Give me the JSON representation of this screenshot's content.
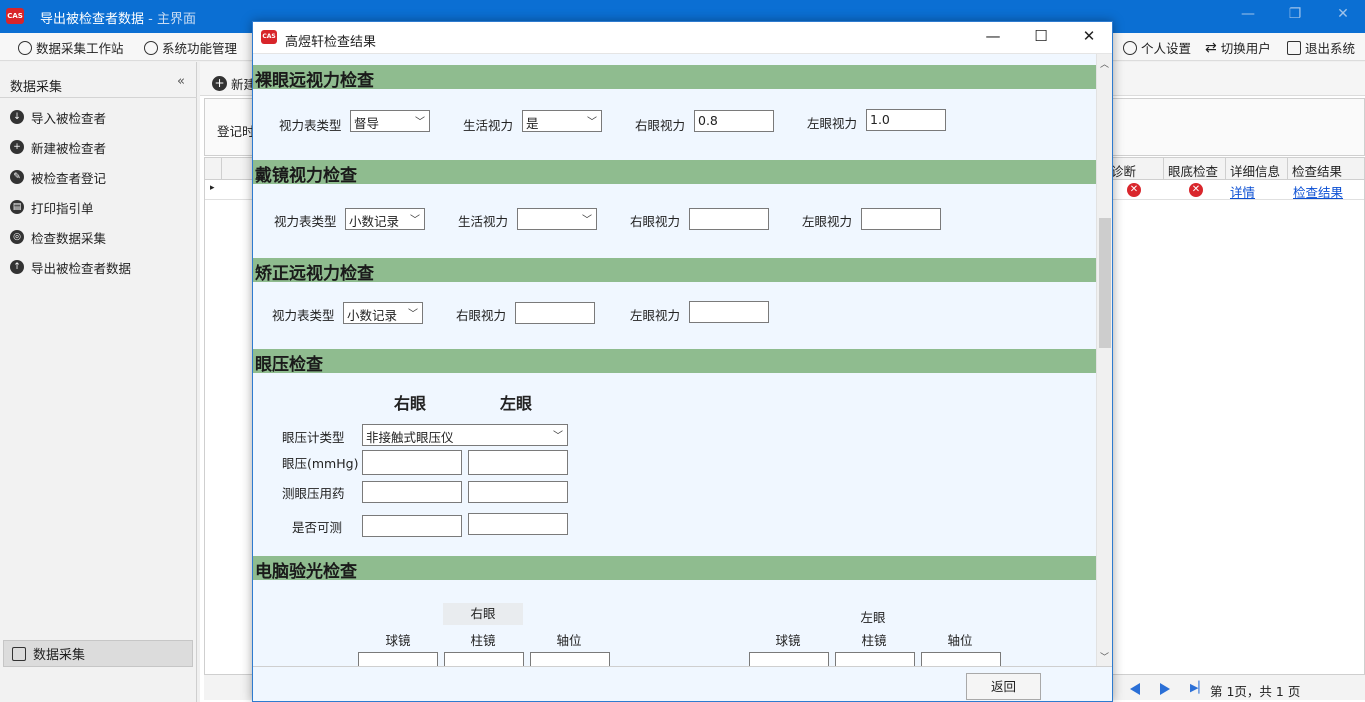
{
  "window": {
    "title": "导出被检查者数据",
    "subtitle": " - 主界面",
    "min": "—",
    "max": "❐",
    "close": "✕"
  },
  "toolbar": {
    "items": [
      "数据采集工作站",
      "系统功能管理"
    ],
    "right": [
      "个人设置",
      "切换用户",
      "退出系统"
    ]
  },
  "sidebar": {
    "header": "数据采集",
    "collapse": "«",
    "items": [
      "导入被检查者",
      "新建被检查者",
      "被检查者登记",
      "打印指引单",
      "检查数据采集",
      "导出被检查者数据"
    ],
    "bottom": "数据采集"
  },
  "main": {
    "new_label": "新建",
    "filter_label": "登记时",
    "grid_headers": [
      "诊断",
      "眼底检查",
      "详细信息",
      "检查结果"
    ],
    "row": {
      "details": "详情",
      "result": "检查结果"
    },
    "pager_text": "第 1页，共 1 页"
  },
  "dialog": {
    "title": "高煜轩检查结果",
    "min": "—",
    "max": "☐",
    "close": "✕",
    "naked": {
      "title": "裸眼远视力检查",
      "chart_type_label": "视力表类型",
      "chart_type_value": "督导",
      "life_label": "生活视力",
      "life_value": "是",
      "right_label": "右眼视力",
      "right_value": "0.8",
      "left_label": "左眼视力",
      "left_value": "1.0"
    },
    "glasses": {
      "title": "戴镜视力检查",
      "chart_type_label": "视力表类型",
      "chart_type_value": "小数记录",
      "life_label": "生活视力",
      "life_value": "",
      "right_label": "右眼视力",
      "right_value": "",
      "left_label": "左眼视力",
      "left_value": ""
    },
    "corrected": {
      "title": "矫正远视力检查",
      "chart_type_label": "视力表类型",
      "chart_type_value": "小数记录",
      "right_label": "右眼视力",
      "right_value": "",
      "left_label": "左眼视力",
      "left_value": ""
    },
    "iop": {
      "title": "眼压检查",
      "right_head": "右眼",
      "left_head": "左眼",
      "type_label": "眼压计类型",
      "type_value": "非接触式眼压仪",
      "iop_label": "眼压(mmHg)",
      "drug_label": "测眼压用药",
      "measurable_label": "是否可测"
    },
    "refraction": {
      "title": "电脑验光检查",
      "right_head": "右眼",
      "left_head": "左眼",
      "cols": [
        "球镜",
        "柱镜",
        "轴位"
      ]
    },
    "back_button": "返回"
  }
}
